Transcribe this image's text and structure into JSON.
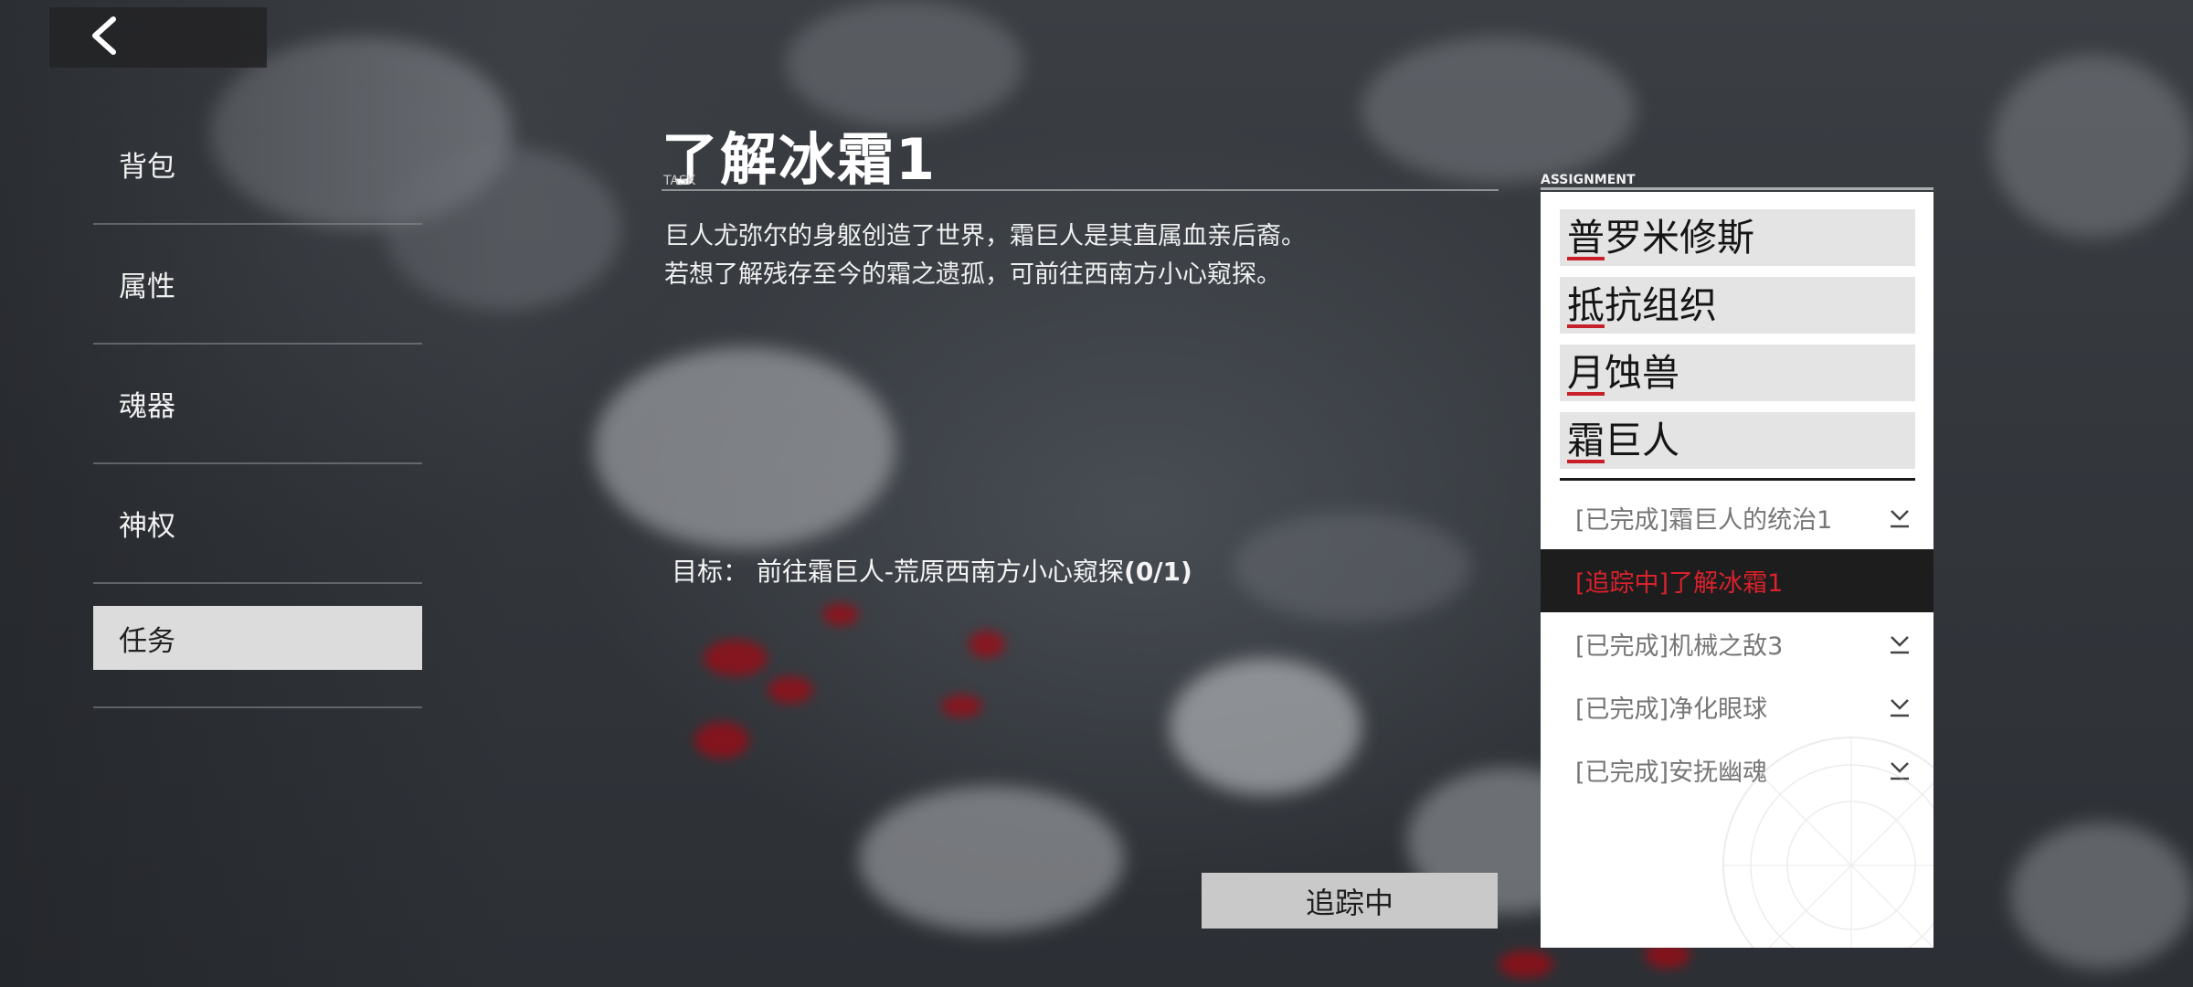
{
  "nav": {
    "back_icon": "chevron-left-icon",
    "items": [
      {
        "label": "背包"
      },
      {
        "label": "属性"
      },
      {
        "label": "魂器"
      },
      {
        "label": "神权"
      },
      {
        "label": "任务",
        "active": true
      }
    ]
  },
  "task": {
    "title": "了解冰霜1",
    "tag": "TASK",
    "description": [
      "巨人尤弥尔的身躯创造了世界，霜巨人是其直属血亲后裔。",
      "若想了解残存至今的霜之遗孤，可前往西南方小心窥探。"
    ],
    "goal_label": "目标：",
    "goal_text": "前往霜巨人-荒原西南方小心窥探",
    "goal_count": "(0/1)",
    "track_button": "追踪中"
  },
  "assignment": {
    "tag": "ASSIGNMENT",
    "categories": [
      {
        "first": "普",
        "rest": "罗米修斯"
      },
      {
        "first": "抵",
        "rest": "抗组织"
      },
      {
        "first": "月",
        "rest": "蚀兽"
      },
      {
        "first": "霜",
        "rest": "巨人"
      }
    ],
    "tasks": [
      {
        "label": "[已完成]霜巨人的统治1",
        "state": "completed",
        "icon": "chevron-down-icon"
      },
      {
        "label": "[追踪中]了解冰霜1",
        "state": "tracking",
        "icon": ""
      },
      {
        "label": "[已完成]机械之敌3",
        "state": "completed",
        "icon": "chevron-down-icon"
      },
      {
        "label": "[已完成]净化眼球",
        "state": "completed",
        "icon": "chevron-down-icon"
      },
      {
        "label": "[已完成]安抚幽魂",
        "state": "completed",
        "icon": "chevron-down-icon"
      }
    ]
  },
  "colors": {
    "accent_red": "#d8222c",
    "active_tab_bg": "#dcdcdc",
    "panel_bg": "#ffffff",
    "tracking_row_bg": "#1d1d1d"
  }
}
